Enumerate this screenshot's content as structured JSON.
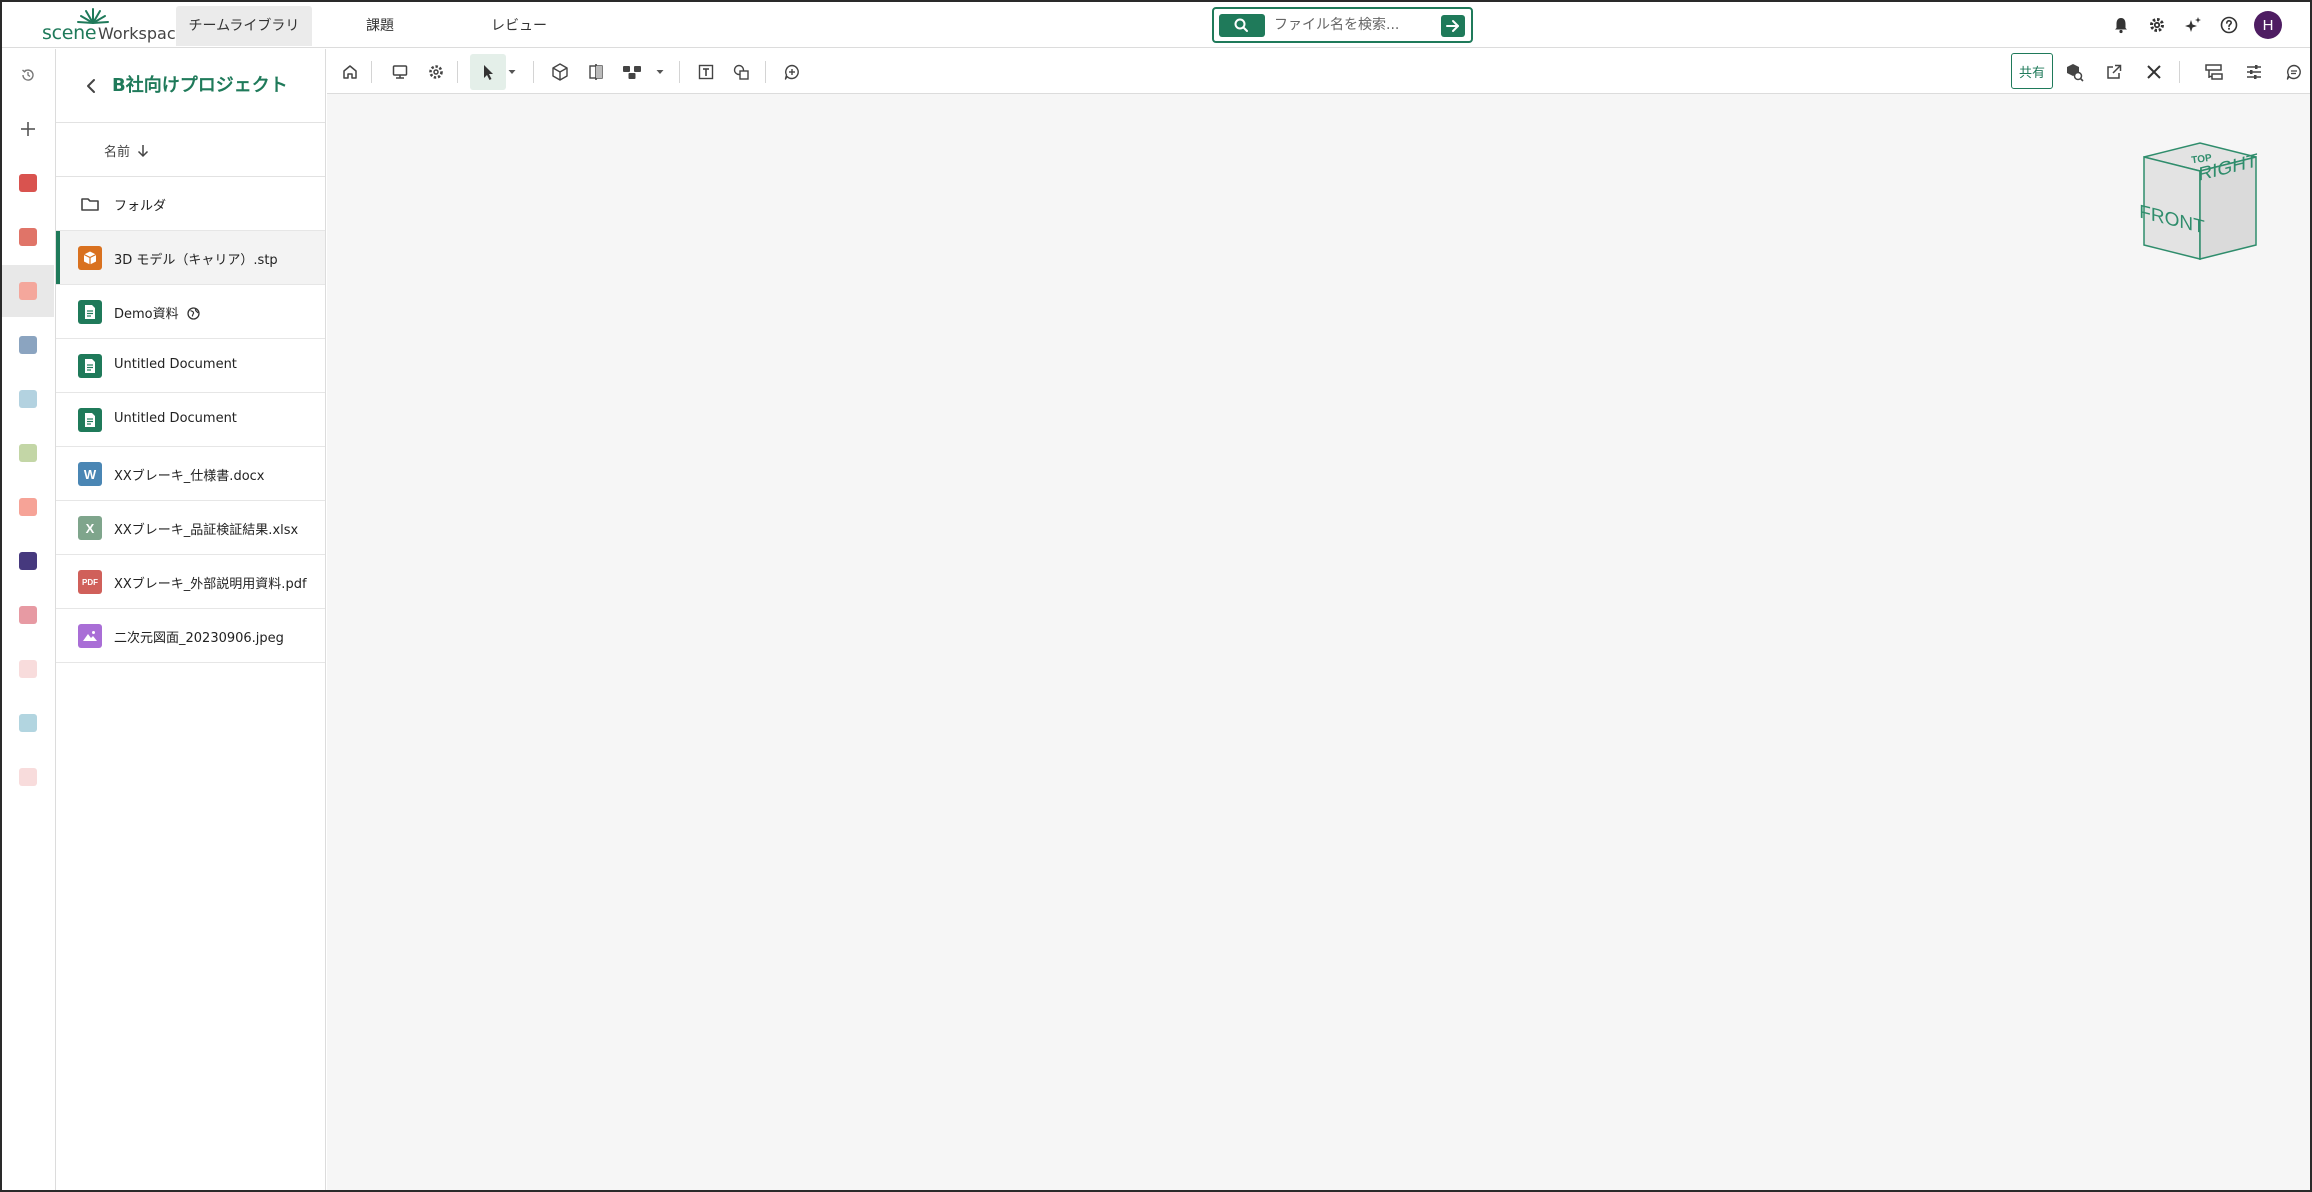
{
  "app": {
    "logo_primary": "scene",
    "logo_secondary": "Workspace"
  },
  "nav": {
    "tabs": [
      {
        "label": "チームライブラリ",
        "active": true
      },
      {
        "label": "課題",
        "active": false
      },
      {
        "label": "レビュー",
        "active": false
      }
    ]
  },
  "search": {
    "placeholder": "ファイル名を検索...",
    "button_icon": "search-icon",
    "go_icon": "arrow-right-icon"
  },
  "header_icons": [
    "bell-icon",
    "gear-icon",
    "sparkle-icon",
    "help-icon"
  ],
  "user": {
    "avatar_letter": "H",
    "avatar_color": "#4e1d62"
  },
  "rail": {
    "icons": [
      "history-icon",
      "plus-icon"
    ],
    "swatches": [
      "#d9534f",
      "#e07468",
      "#f4a79c",
      "#8ba4c0",
      "#b3d2e0",
      "#c3d6a6",
      "#f6a397",
      "#46397e",
      "#e79aa3",
      "#f8dcdc",
      "#b2d5e0",
      "#f8dcdc"
    ],
    "active_index": 2
  },
  "panel": {
    "title": "B社向けプロジェクト",
    "sort_label": "名前",
    "files": [
      {
        "name": "フォルダ",
        "type": "folder",
        "icon": "folder-icon"
      },
      {
        "name": "3D モデル（キャリア）.stp",
        "type": "3d",
        "icon": "cube-icon",
        "color": "#d9711f",
        "selected": true
      },
      {
        "name": "Demo資料",
        "type": "doc",
        "icon": "document-icon",
        "color": "#1f7a5a",
        "public": true
      },
      {
        "name": "Untitled Document",
        "type": "doc",
        "icon": "document-icon",
        "color": "#1f7a5a"
      },
      {
        "name": "Untitled Document",
        "type": "doc",
        "icon": "document-icon",
        "color": "#1f7a5a"
      },
      {
        "name": "XXブレーキ_仕様書.docx",
        "type": "word",
        "icon": "word-icon",
        "glyph": "W",
        "color": "#4a86b4"
      },
      {
        "name": "XXブレーキ_品証検証結果.xlsx",
        "type": "excel",
        "icon": "excel-icon",
        "glyph": "X",
        "color": "#7fa58c"
      },
      {
        "name": "XXブレーキ_外部説明用資料.pdf",
        "type": "pdf",
        "icon": "pdf-icon",
        "glyph": "PDF",
        "color": "#d0605a"
      },
      {
        "name": "二次元図面_20230906.jpeg",
        "type": "image",
        "icon": "image-icon",
        "color": "#a96ed6"
      }
    ]
  },
  "toolbar": {
    "share_label": "共有",
    "left_icons": [
      "home-icon",
      "screen-icon",
      "settings-icon",
      "select-cursor-icon",
      "box-view-icon",
      "section-icon",
      "explode-icon",
      "text-box-icon",
      "shapes-icon",
      "add-comment-icon"
    ],
    "right_icons": [
      "search-part-icon",
      "open-external-icon",
      "close-icon",
      "tree-icon",
      "adjust-icon",
      "comment-icon"
    ]
  },
  "viewcube": {
    "front": "FRONT",
    "right": "RIGHT",
    "top": "TOP"
  }
}
